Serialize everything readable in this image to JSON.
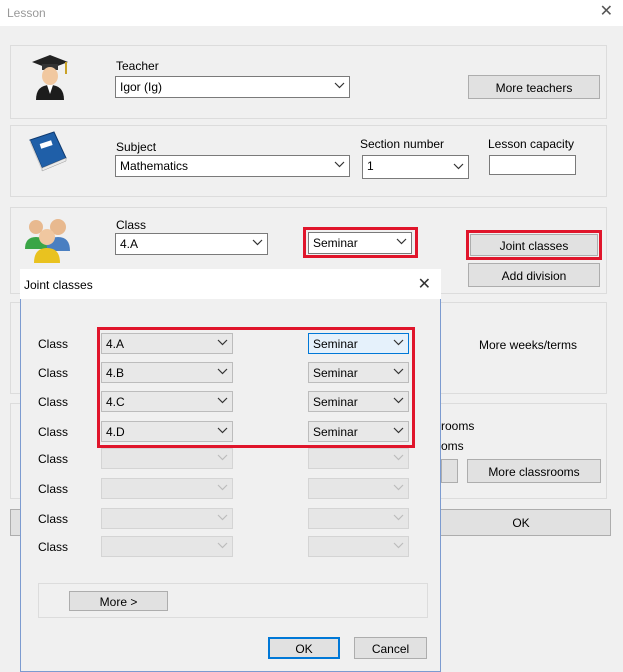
{
  "window": {
    "title": "Lesson"
  },
  "teacher": {
    "label": "Teacher",
    "value": "Igor (Ig)",
    "more_button": "More teachers"
  },
  "subject": {
    "label": "Subject",
    "value": "Mathematics",
    "section_label": "Section number",
    "section_value": "1",
    "capacity_label": "Lesson capacity",
    "capacity_value": ""
  },
  "classes": {
    "label": "Class",
    "class_value": "4.A",
    "type_value": "Seminar",
    "joint_button": "Joint classes",
    "division_button": "Add division"
  },
  "weeks": {
    "more_button": "More weeks/terms"
  },
  "rooms": {
    "line1": "rooms",
    "line2": "oms",
    "more_button": "More classrooms"
  },
  "main_ok": "OK",
  "dialog": {
    "title": "Joint classes",
    "row_label": "Class",
    "rows": [
      {
        "cls": "4.A",
        "type": "Seminar"
      },
      {
        "cls": "4.B",
        "type": "Seminar"
      },
      {
        "cls": "4.C",
        "type": "Seminar"
      },
      {
        "cls": "4.D",
        "type": "Seminar"
      },
      {
        "cls": "",
        "type": ""
      },
      {
        "cls": "",
        "type": ""
      },
      {
        "cls": "",
        "type": ""
      },
      {
        "cls": "",
        "type": ""
      }
    ],
    "more_button": "More >",
    "ok": "OK",
    "cancel": "Cancel"
  },
  "colors": {
    "highlight": "#e0152b",
    "accent": "#0078d7"
  }
}
